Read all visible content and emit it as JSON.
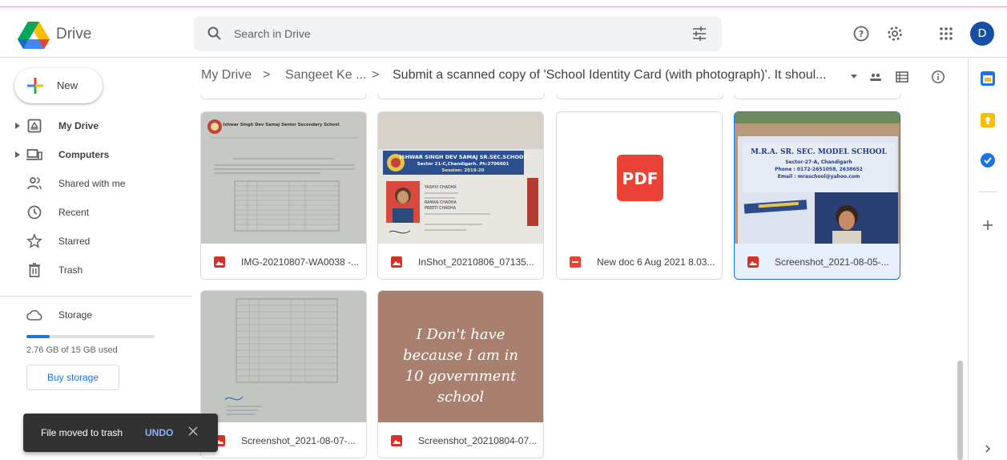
{
  "header": {
    "brand": "Drive",
    "search_placeholder": "Search in Drive",
    "avatar_letter": "D"
  },
  "sidebar": {
    "new_label": "New",
    "items": [
      {
        "label": "My Drive",
        "icon": "drive-icon"
      },
      {
        "label": "Computers",
        "icon": "computer-icon"
      },
      {
        "label": "Shared with me",
        "icon": "shared-icon"
      },
      {
        "label": "Recent",
        "icon": "clock-icon"
      },
      {
        "label": "Starred",
        "icon": "star-icon"
      },
      {
        "label": "Trash",
        "icon": "trash-icon"
      }
    ],
    "storage": {
      "label": "Storage",
      "used_text": "2.76 GB of 15 GB used",
      "used_fraction": 0.184,
      "buy_label": "Buy storage"
    }
  },
  "breadcrumb": {
    "items": [
      "My Drive",
      "Sangeet Ke ...",
      "Submit a scanned copy of 'School Identity Card (with photograph)'. It shoul..."
    ],
    "separator": ">"
  },
  "files": [
    {
      "name": "IMG-20210807-WA0038 -...",
      "type": "image"
    },
    {
      "name": "InShot_20210806_07135...",
      "type": "image"
    },
    {
      "name": "New doc 6 Aug 2021 8.03...",
      "type": "pdf"
    },
    {
      "name": "Screenshot_2021-08-05-...",
      "type": "image",
      "selected": true
    },
    {
      "name": "Screenshot_2021-08-07-...",
      "type": "image"
    },
    {
      "name": "Screenshot_20210804-07...",
      "type": "image"
    }
  ],
  "thumbnails": {
    "pdf_label": "PDF",
    "id_card_school": "ISHWAR SINGH DEV SAMAJ SR.SEC.SCHOOL",
    "id_card_address": "Sector 21-C,Chandigarh. Ph:2706601",
    "id_card_session": "Session: 2019-20",
    "id_card_name": "YASHVI CHADHA",
    "id_card_father": "RAMAN CHADHA",
    "id_card_mother": "PREETI CHADHA",
    "model_school": "M.R.A. SR. SEC. MODEL SCHOOL",
    "model_sector": "Sector-27-A, Chandigarh",
    "model_phone": "Phone : 0172-2651058, 2638652",
    "model_email": "Email : mraschool@yahoo.com",
    "letter_school": "Ishwar Singh Dev Samaj Senior Secondary School",
    "quote_lines": [
      "I Don't have",
      "because I am in",
      "10 government",
      "school"
    ]
  },
  "snackbar": {
    "message": "File moved to trash",
    "undo_label": "UNDO"
  },
  "colors": {
    "accent": "#1a73e8",
    "pdf_red": "#ea4335",
    "quote_bg": "#a9806d"
  }
}
